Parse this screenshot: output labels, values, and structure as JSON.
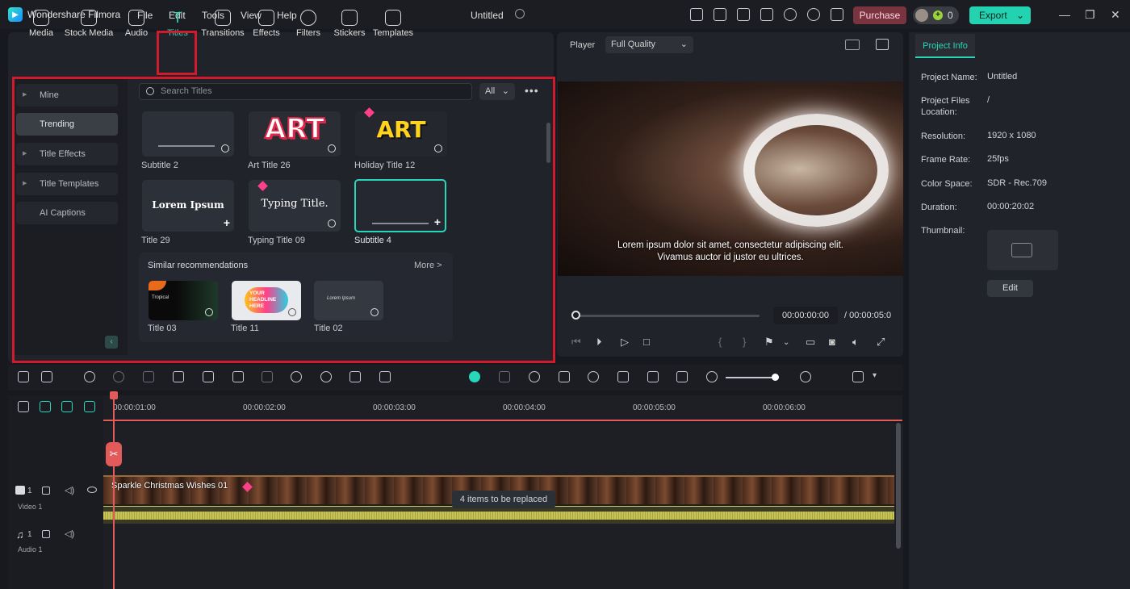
{
  "app": {
    "name": "Wondershare Filmora",
    "doc_title": "Untitled"
  },
  "menu": [
    "File",
    "Edit",
    "Tools",
    "View",
    "Help"
  ],
  "header": {
    "purchase": "Purchase",
    "credits": "0",
    "export": "Export"
  },
  "categories": [
    {
      "label": "Media",
      "icon": "media-icon"
    },
    {
      "label": "Stock Media",
      "icon": "stock-media-icon"
    },
    {
      "label": "Audio",
      "icon": "audio-icon"
    },
    {
      "label": "Titles",
      "icon": "titles-icon",
      "active": true
    },
    {
      "label": "Transitions",
      "icon": "transitions-icon"
    },
    {
      "label": "Effects",
      "icon": "effects-icon"
    },
    {
      "label": "Filters",
      "icon": "filters-icon"
    },
    {
      "label": "Stickers",
      "icon": "stickers-icon"
    },
    {
      "label": "Templates",
      "icon": "templates-icon"
    }
  ],
  "sidebar": [
    "Mine",
    "Trending",
    "Title Effects",
    "Title Templates",
    "AI Captions"
  ],
  "search": {
    "placeholder": "Search Titles",
    "filter": "All"
  },
  "titles": [
    {
      "label": "Subtitle 2",
      "art": ""
    },
    {
      "label": "Art Title 26",
      "art": "ART"
    },
    {
      "label": "Holiday Title 12",
      "art": "ART"
    },
    {
      "label": "Title 29",
      "art": "Lorem Ipsum"
    },
    {
      "label": "Typing Title 09",
      "art": "Typing Title."
    },
    {
      "label": "Subtitle 4",
      "art": ""
    }
  ],
  "similar": {
    "heading": "Similar recommendations",
    "more": "More >",
    "items": [
      {
        "label": "Title 03",
        "art": "Tropical"
      },
      {
        "label": "Title 11",
        "art": "YOUR HEADLINE HERE"
      },
      {
        "label": "Title 02",
        "art": "Lorem Ipsum"
      }
    ]
  },
  "player": {
    "label": "Player",
    "quality": "Full Quality",
    "subtitle_line1": "Lorem ipsum dolor sit amet, consectetur adipiscing elit.",
    "subtitle_line2": "Vivamus auctor id justor eu ultrices.",
    "current_time": "00:00:00:00",
    "total_time": "/ 00:00:05:0"
  },
  "project_info": {
    "tab": "Project Info",
    "rows": [
      {
        "k": "Project Name:",
        "v": "Untitled"
      },
      {
        "k": "Project Files Location:",
        "v": "/"
      },
      {
        "k": "Resolution:",
        "v": "1920 x 1080"
      },
      {
        "k": "Frame Rate:",
        "v": "25fps"
      },
      {
        "k": "Color Space:",
        "v": "SDR - Rec.709"
      },
      {
        "k": "Duration:",
        "v": "00:00:20:02"
      },
      {
        "k": "Thumbnail:",
        "v": ""
      }
    ],
    "edit": "Edit"
  },
  "timeline": {
    "ticks": [
      "00:00:01:00",
      "00:00:02:00",
      "00:00:03:00",
      "00:00:04:00",
      "00:00:05:00",
      "00:00:06:00"
    ],
    "clip_title": "Sparkle Christmas Wishes 01",
    "replace_note": "4 items to be replaced",
    "video_track": {
      "num": "1",
      "label": "Video 1"
    },
    "audio_track": {
      "num": "1",
      "label": "Audio 1"
    }
  },
  "colors": {
    "accent": "#28d7b9",
    "highlight": "#d11b2c",
    "playhead": "#e25a5a"
  }
}
